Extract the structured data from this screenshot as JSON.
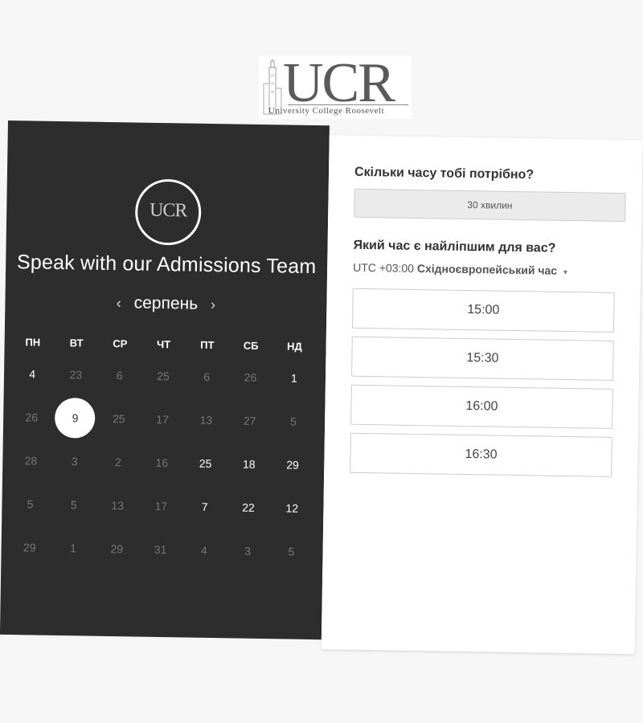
{
  "header": {
    "logo_text": "UCR",
    "logo_subtitle": "University College Roosevelt"
  },
  "left": {
    "circle_logo_text": "UCR",
    "title": "Speak with our Admissions Team",
    "month": "серпень",
    "prev_icon": "‹",
    "next_icon": "›",
    "weekdays": [
      "ПН",
      "ВТ",
      "СР",
      "ЧТ",
      "ПТ",
      "СБ",
      "НД"
    ],
    "weeks": [
      [
        {
          "d": "4",
          "s": "avail"
        },
        {
          "d": "23",
          "s": "off"
        },
        {
          "d": "6",
          "s": "off"
        },
        {
          "d": "25",
          "s": "off"
        },
        {
          "d": "6",
          "s": "off"
        },
        {
          "d": "26",
          "s": "off"
        },
        {
          "d": "1",
          "s": "avail"
        }
      ],
      [
        {
          "d": "26",
          "s": "off"
        },
        {
          "d": "9",
          "s": "selected"
        },
        {
          "d": "25",
          "s": "off"
        },
        {
          "d": "17",
          "s": "off"
        },
        {
          "d": "13",
          "s": "off"
        },
        {
          "d": "27",
          "s": "off"
        },
        {
          "d": "5",
          "s": "off"
        }
      ],
      [
        {
          "d": "28",
          "s": "off"
        },
        {
          "d": "3",
          "s": "off"
        },
        {
          "d": "2",
          "s": "off"
        },
        {
          "d": "16",
          "s": "off"
        },
        {
          "d": "25",
          "s": "avail"
        },
        {
          "d": "18",
          "s": "avail"
        },
        {
          "d": "29",
          "s": "avail"
        }
      ],
      [
        {
          "d": "5",
          "s": "off"
        },
        {
          "d": "5",
          "s": "off"
        },
        {
          "d": "13",
          "s": "off"
        },
        {
          "d": "17",
          "s": "off"
        },
        {
          "d": "7",
          "s": "avail"
        },
        {
          "d": "22",
          "s": "avail"
        },
        {
          "d": "12",
          "s": "avail"
        }
      ],
      [
        {
          "d": "29",
          "s": "off"
        },
        {
          "d": "1",
          "s": "off"
        },
        {
          "d": "29",
          "s": "off"
        },
        {
          "d": "31",
          "s": "off"
        },
        {
          "d": "4",
          "s": "off"
        },
        {
          "d": "3",
          "s": "off"
        },
        {
          "d": "5",
          "s": "off"
        }
      ]
    ]
  },
  "right": {
    "duration_question": "Скільки часу тобі потрібно?",
    "duration_value": "30 хвилин",
    "time_question": "Який час є найліпшим для вас?",
    "tz_offset": "UTC +03:00",
    "tz_name": "Східноєвропейський час",
    "tz_caret": "▾",
    "slots": [
      "15:00",
      "15:30",
      "16:00",
      "16:30"
    ]
  }
}
